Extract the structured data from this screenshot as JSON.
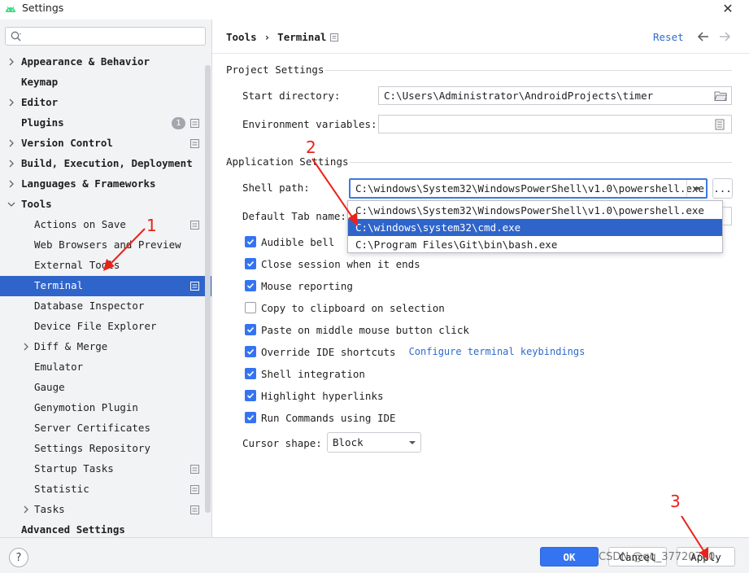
{
  "window": {
    "title": "Settings"
  },
  "search": {
    "placeholder": "",
    "value": ""
  },
  "sidebar": {
    "items": [
      {
        "label": "Appearance & Behavior",
        "bold": true
      },
      {
        "label": "Keymap",
        "bold": true
      },
      {
        "label": "Editor",
        "bold": true
      },
      {
        "label": "Plugins",
        "bold": true,
        "badge": "1"
      },
      {
        "label": "Version Control",
        "bold": true
      },
      {
        "label": "Build, Execution, Deployment",
        "bold": true
      },
      {
        "label": "Languages & Frameworks",
        "bold": true
      },
      {
        "label": "Tools",
        "bold": true
      },
      {
        "label": "Actions on Save"
      },
      {
        "label": "Web Browsers and Preview"
      },
      {
        "label": "External Tools"
      },
      {
        "label": "Terminal",
        "selected": true
      },
      {
        "label": "Database Inspector"
      },
      {
        "label": "Device File Explorer"
      },
      {
        "label": "Diff & Merge"
      },
      {
        "label": "Emulator"
      },
      {
        "label": "Gauge"
      },
      {
        "label": "Genymotion Plugin"
      },
      {
        "label": "Server Certificates"
      },
      {
        "label": "Settings Repository"
      },
      {
        "label": "Startup Tasks"
      },
      {
        "label": "Statistic"
      },
      {
        "label": "Tasks"
      },
      {
        "label": "Advanced Settings",
        "bold": true
      }
    ]
  },
  "header": {
    "breadcrumb": [
      "Tools",
      "Terminal"
    ],
    "separator": "›",
    "reset_label": "Reset"
  },
  "project_settings": {
    "title": "Project Settings",
    "start_directory_label": "Start directory:",
    "start_directory_value": "C:\\Users\\Administrator\\AndroidProjects\\timer",
    "env_vars_label": "Environment variables:",
    "env_vars_value": ""
  },
  "app_settings": {
    "title": "Application Settings",
    "shell_path_label": "Shell path:",
    "shell_path_value": "C:\\windows\\System32\\WindowsPowerShell\\v1.0\\powershell.exe",
    "ellipsis_label": "...",
    "default_tab_label": "Default Tab name:",
    "shell_options": [
      "C:\\windows\\System32\\WindowsPowerShell\\v1.0\\powershell.exe",
      "C:\\windows\\system32\\cmd.exe",
      "C:\\Program Files\\Git\\bin\\bash.exe"
    ],
    "checkboxes": [
      {
        "label": "Audible bell",
        "checked": true
      },
      {
        "label": "Close session when it ends",
        "checked": true
      },
      {
        "label": "Mouse reporting",
        "checked": true
      },
      {
        "label": "Copy to clipboard on selection",
        "checked": false
      },
      {
        "label": "Paste on middle mouse button click",
        "checked": true
      },
      {
        "label": "Override IDE shortcuts",
        "checked": true,
        "link": "Configure terminal keybindings"
      },
      {
        "label": "Shell integration",
        "checked": true
      },
      {
        "label": "Highlight hyperlinks",
        "checked": true
      },
      {
        "label": "Run Commands using IDE",
        "checked": true
      }
    ],
    "cursor_shape_label": "Cursor shape:",
    "cursor_shape_value": "Block"
  },
  "footer": {
    "help_label": "?",
    "ok_label": "OK",
    "cancel_label": "Cancel",
    "apply_label": "Apply"
  },
  "annotations": {
    "n1": "1",
    "n2": "2",
    "n3": "3"
  },
  "watermark": "CSDN @qq_37720700",
  "colors": {
    "accent": "#2f65ca",
    "link": "#2c6bcb",
    "annotation": "#e8231b"
  }
}
